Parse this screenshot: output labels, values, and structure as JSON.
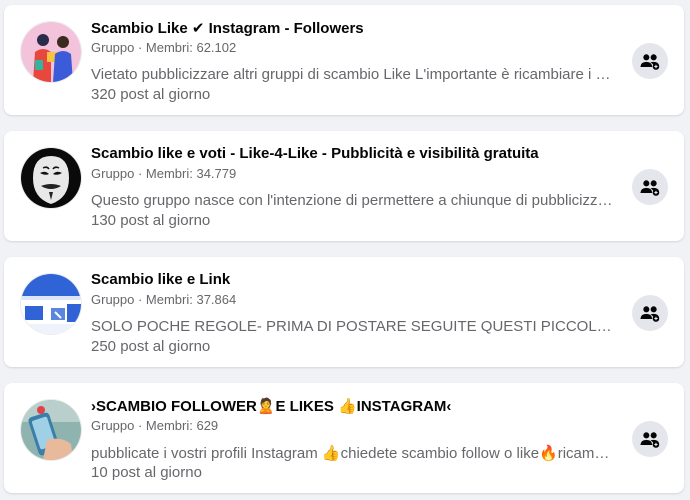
{
  "groups": [
    {
      "name": "Scambio Like ✔ Instagram - Followers",
      "meta": "Gruppo · Membri: 62.102",
      "description": "Vietato pubblicizzare altri gruppi di scambio Like L'importante è ricambiare i like",
      "posts": "320 post al giorno",
      "avatar": "two-people-illustration"
    },
    {
      "name": "Scambio like e voti - Like-4-Like - Pubblicità e visibilità gratuita",
      "meta": "Gruppo · Membri: 34.779",
      "description": "Questo gruppo nasce con l'intenzione di permettere a chiunque di pubblicizzare",
      "posts": "130 post al giorno",
      "avatar": "anonymous-mask"
    },
    {
      "name": "Scambio like e Link",
      "meta": "Gruppo · Membri: 37.864",
      "description": "SOLO POCHE REGOLE- PRIMA DI POSTARE SEGUITE QUESTI PICCOLI PASSI",
      "posts": "250 post al giorno",
      "avatar": "link-banner"
    },
    {
      "name": "›SCAMBIO FOLLOWER🙎E LIKES 👍INSTAGRAM‹",
      "meta": "Gruppo · Membri: 629",
      "description": "pubblicate i vostri profili Instagram 👍chiedete scambio follow o like🔥ricambiate",
      "posts": "10 post al giorno",
      "avatar": "phone-in-hand"
    }
  ],
  "join_icon": "group-join-icon",
  "colors": {
    "background": "#f0f2f5",
    "card": "#ffffff",
    "title": "#050505",
    "secondary_text": "#65676b",
    "button_bg": "#e4e6eb"
  }
}
